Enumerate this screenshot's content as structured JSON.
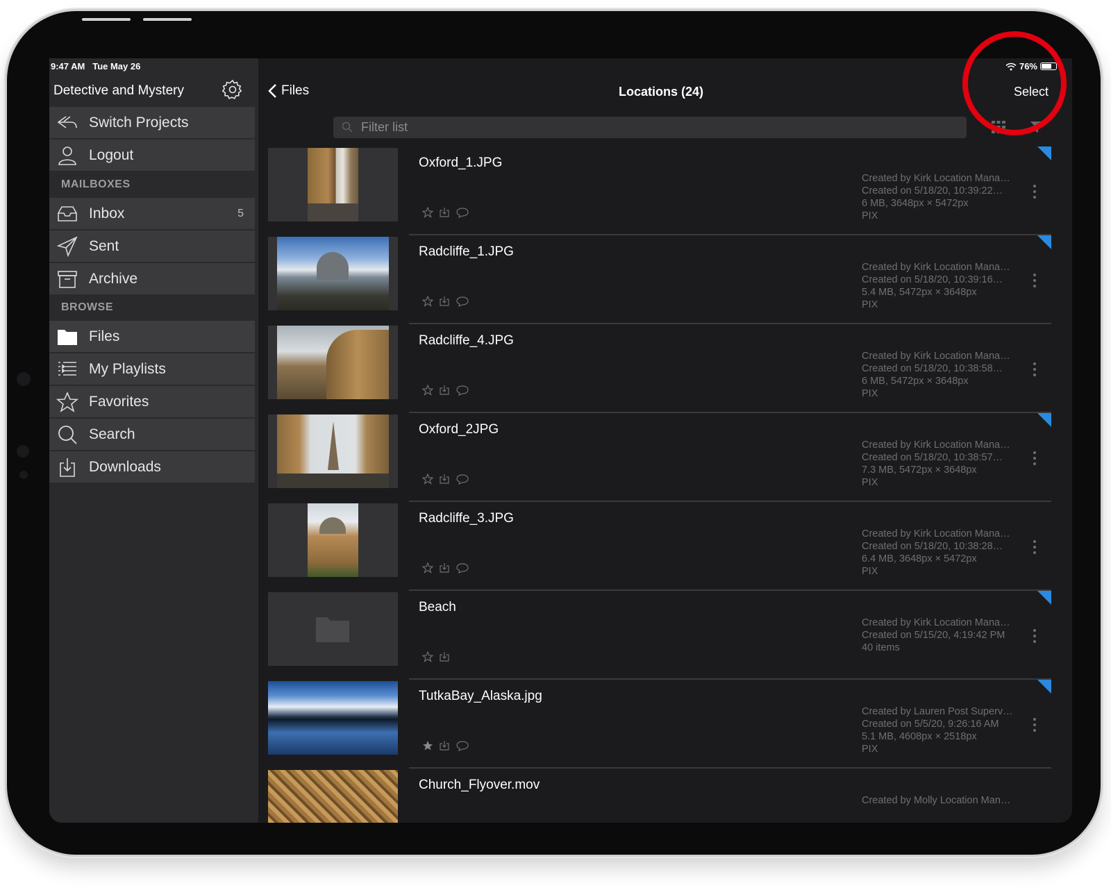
{
  "status": {
    "time": "9:47 AM",
    "date": "Tue May 26",
    "battery_pct": "76%",
    "battery_level": 0.76
  },
  "sidebar": {
    "project_title": "Detective and Mystery",
    "top_items": [
      {
        "label": "Switch Projects",
        "icon": "switch-projects-icon"
      },
      {
        "label": "Logout",
        "icon": "user-icon"
      }
    ],
    "mailboxes_header": "MAILBOXES",
    "mailboxes": [
      {
        "label": "Inbox",
        "icon": "inbox-icon",
        "badge": "5"
      },
      {
        "label": "Sent",
        "icon": "paper-plane-icon",
        "badge": ""
      },
      {
        "label": "Archive",
        "icon": "archive-box-icon",
        "badge": ""
      }
    ],
    "browse_header": "BROWSE",
    "browse": [
      {
        "label": "Files",
        "icon": "folder-icon"
      },
      {
        "label": "My Playlists",
        "icon": "playlist-icon"
      },
      {
        "label": "Favorites",
        "icon": "star-icon"
      },
      {
        "label": "Search",
        "icon": "magnifier-icon"
      },
      {
        "label": "Downloads",
        "icon": "download-icon"
      }
    ]
  },
  "header": {
    "back_label": "Files",
    "title": "Locations (24)",
    "select_label": "Select"
  },
  "filter": {
    "placeholder": "Filter list"
  },
  "files": [
    {
      "name": "Oxford_1.JPG",
      "meta": [
        "Created by Kirk Location Mana…",
        "Created on 5/18/20, 10:39:22…",
        "6 MB, 3648px × 5472px",
        "PIX"
      ],
      "thumb": "portrait-building",
      "starred": false,
      "comments": true,
      "flag": true
    },
    {
      "name": "Radcliffe_1.JPG",
      "meta": [
        "Created by Kirk Location Mana…",
        "Created on 5/18/20, 10:39:16…",
        "5.4 MB, 5472px × 3648px",
        "PIX"
      ],
      "thumb": "dome-sky",
      "starred": false,
      "comments": true,
      "flag": true
    },
    {
      "name": "Radcliffe_4.JPG",
      "meta": [
        "Created by Kirk Location Mana…",
        "Created on 5/18/20, 10:38:58…",
        "6 MB, 5472px × 3648px",
        "PIX"
      ],
      "thumb": "rotunda",
      "starred": false,
      "comments": true,
      "flag": false
    },
    {
      "name": "Oxford_2JPG",
      "meta": [
        "Created by Kirk Location Mana…",
        "Created on 5/18/20, 10:38:57…",
        "7.3 MB, 5472px × 3648px",
        "PIX"
      ],
      "thumb": "spire",
      "starred": false,
      "comments": true,
      "flag": true
    },
    {
      "name": "Radcliffe_3.JPG",
      "meta": [
        "Created by Kirk Location Mana…",
        "Created on 5/18/20, 10:38:28…",
        "6.4 MB, 3648px × 5472px",
        "PIX"
      ],
      "thumb": "portrait-dome",
      "starred": false,
      "comments": true,
      "flag": false
    },
    {
      "name": "Beach",
      "meta": [
        "Created by Kirk Location Mana…",
        "Created on 5/15/20, 4:19:42 PM",
        "40 items"
      ],
      "thumb": "folder",
      "starred": false,
      "comments": false,
      "flag": true
    },
    {
      "name": "TutkaBay_Alaska.jpg",
      "meta": [
        "Created by Lauren Post Superv…",
        "Created on 5/5/20, 9:26:16 AM",
        "5.1 MB, 4608px × 2518px",
        "PIX"
      ],
      "thumb": "lake",
      "starred": true,
      "comments": true,
      "flag": true
    },
    {
      "name": "Church_Flyover.mov",
      "meta": [
        "Created by Molly Location Man…"
      ],
      "thumb": "town",
      "starred": false,
      "comments": false,
      "flag": false
    }
  ],
  "colors": {
    "accent_flag": "#2a8ae0",
    "annotation_circle": "#e3000f"
  }
}
